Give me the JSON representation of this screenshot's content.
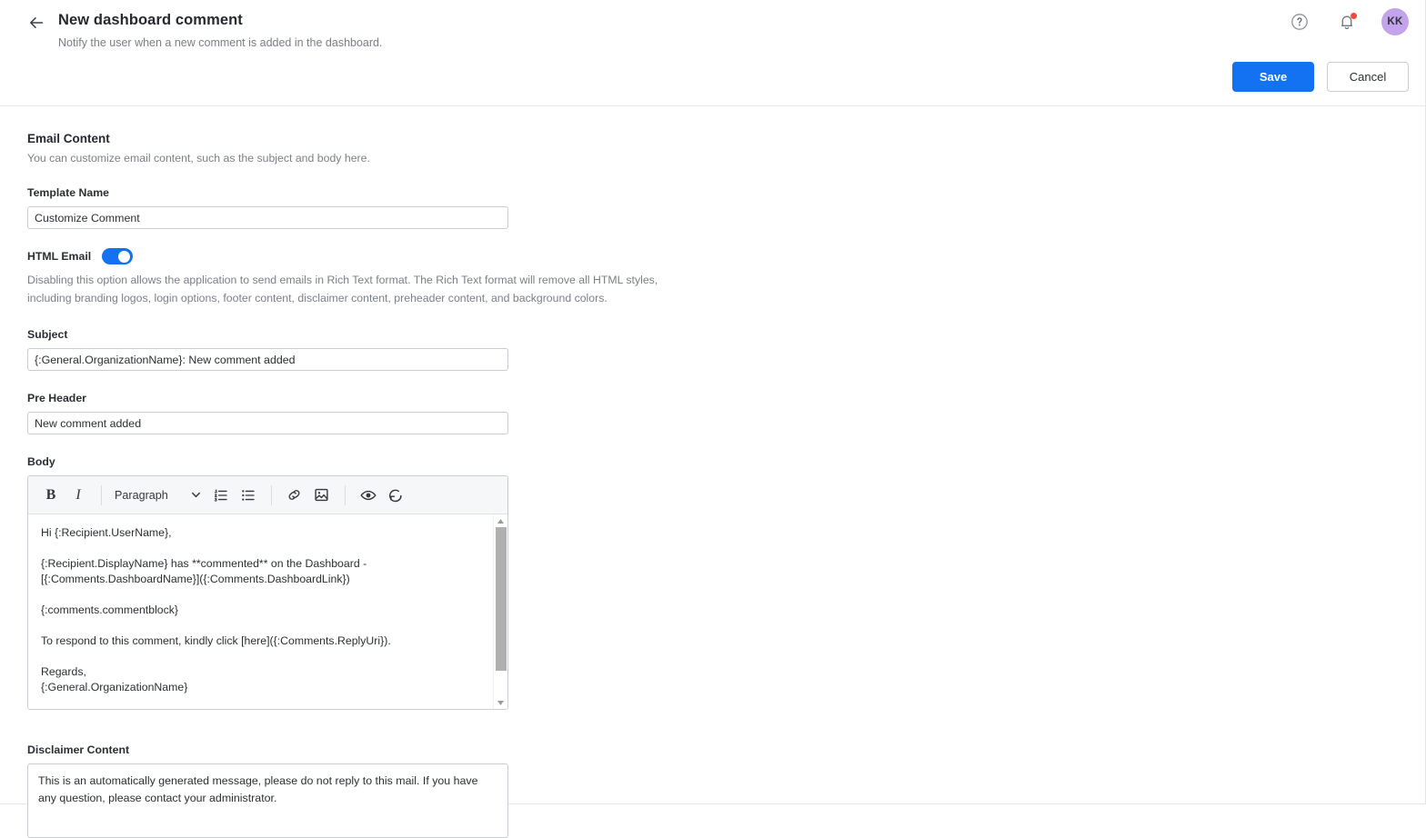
{
  "header": {
    "back_icon": "arrow-left-icon",
    "title": "New dashboard comment",
    "subtitle": "Notify the user when a new comment is added in the dashboard.",
    "help_icon": "help-circle-icon",
    "notifications_icon": "bell-icon",
    "avatar_initials": "KK",
    "avatar_color": "#c3a3ea",
    "notification_badge_color": "#f8443a",
    "save_label": "Save",
    "cancel_label": "Cancel",
    "primary_color": "#1272f2"
  },
  "email_content": {
    "section_title": "Email Content",
    "section_subtitle": "You can customize email content, such as the subject and body here.",
    "template_name_label": "Template Name",
    "template_name_value": "Customize Comment",
    "template_name_placeholder": "Template Name",
    "html_email_label": "HTML Email",
    "html_email_enabled": "on",
    "html_email_help": "Disabling this option allows the application to send emails in Rich Text format. The Rich Text format will remove all HTML styles, including branding logos, login options, footer content, disclaimer content, preheader content, and background colors.",
    "subject_label": "Subject",
    "subject_value": "{:General.OrganizationName}: New comment added",
    "subject_placeholder": "Subject",
    "preheader_label": "Pre Header",
    "preheader_value": "New comment added",
    "preheader_placeholder": "Pre Header",
    "body_label": "Body",
    "body_value": "Hi {:Recipient.UserName},\n\n{:Recipient.DisplayName} has **commented** on the Dashboard - [{:Comments.DashboardName}]({:Comments.DashboardLink})\n\n{:comments.commentblock}\n\nTo respond to this comment, kindly click [here]({:Comments.ReplyUri}).\n\nRegards,\n{:General.OrganizationName}",
    "disclaimer_label": "Disclaimer Content",
    "disclaimer_value": "This is an automatically generated message, please do not reply to this mail. If you have any question, please contact your administrator.",
    "disclaimer_placeholder": "Disclaimer Content"
  },
  "editor_toolbar": {
    "bold_label": "B",
    "italic_label": "I",
    "block_format_value": "Paragraph",
    "icons": {
      "ordered_list": "ordered-list-icon",
      "bullet_list": "bullet-list-icon",
      "link": "link-icon",
      "image": "image-icon",
      "preview": "eye-icon",
      "revert": "revert-icon",
      "chevron": "chevron-down-icon"
    }
  }
}
